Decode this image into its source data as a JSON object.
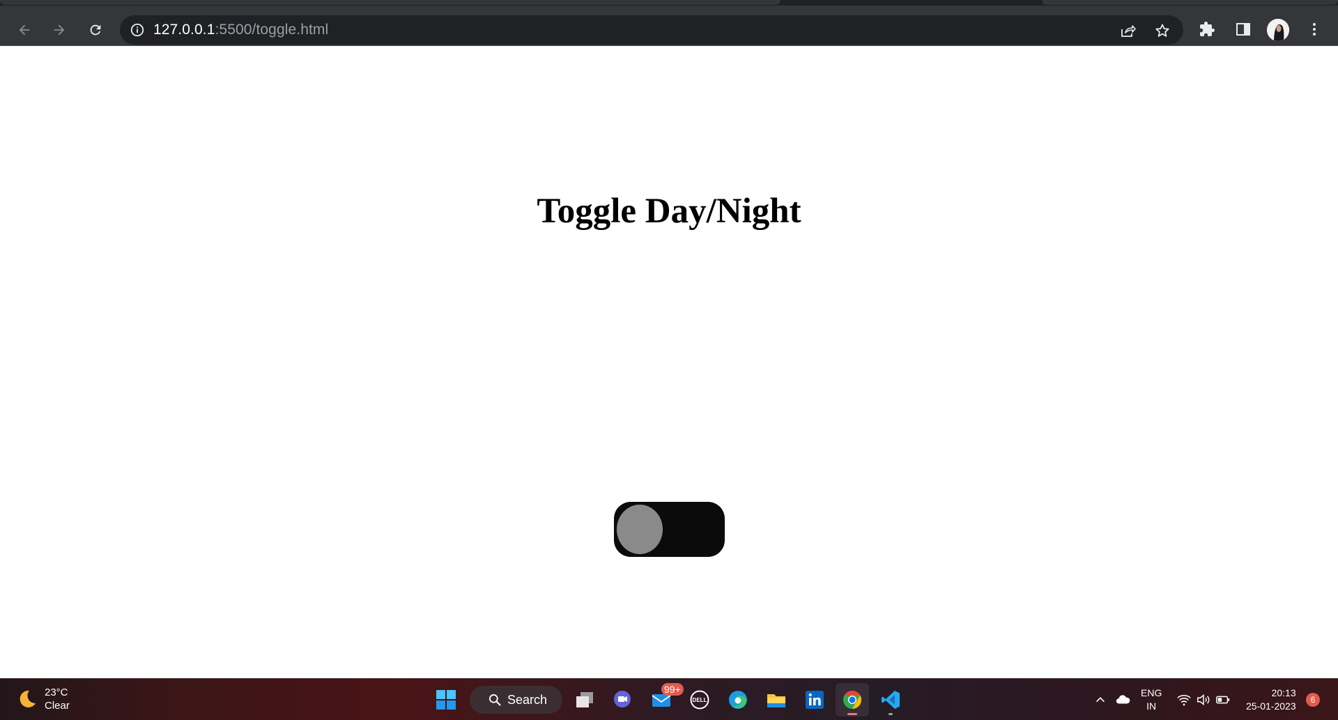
{
  "browser": {
    "url_host": "127.0.0.1",
    "url_rest": ":5500/toggle.html",
    "icons": {
      "back": "back-arrow-icon",
      "forward": "forward-arrow-icon",
      "reload": "reload-icon",
      "site_info": "info-icon",
      "share": "share-icon",
      "bookmark": "star-icon",
      "extensions": "puzzle-icon",
      "side_panel": "side-panel-icon",
      "menu": "kebab-menu-icon"
    }
  },
  "page": {
    "heading": "Toggle Day/Night",
    "toggle": {
      "state": "off",
      "track_color": "#0b0b0b",
      "knob_color": "#8a8a8a"
    }
  },
  "taskbar": {
    "weather": {
      "temperature": "23°C",
      "condition": "Clear"
    },
    "search_label": "Search",
    "mail_badge": "99+",
    "apps": [
      "start",
      "search",
      "task-view",
      "teams-chat",
      "mail",
      "dell",
      "edge",
      "file-explorer",
      "linkedin",
      "chrome",
      "vscode"
    ],
    "tray": {
      "language_top": "ENG",
      "language_bottom": "IN",
      "time": "20:13",
      "date": "25-01-2023",
      "notification_count": "6"
    }
  }
}
